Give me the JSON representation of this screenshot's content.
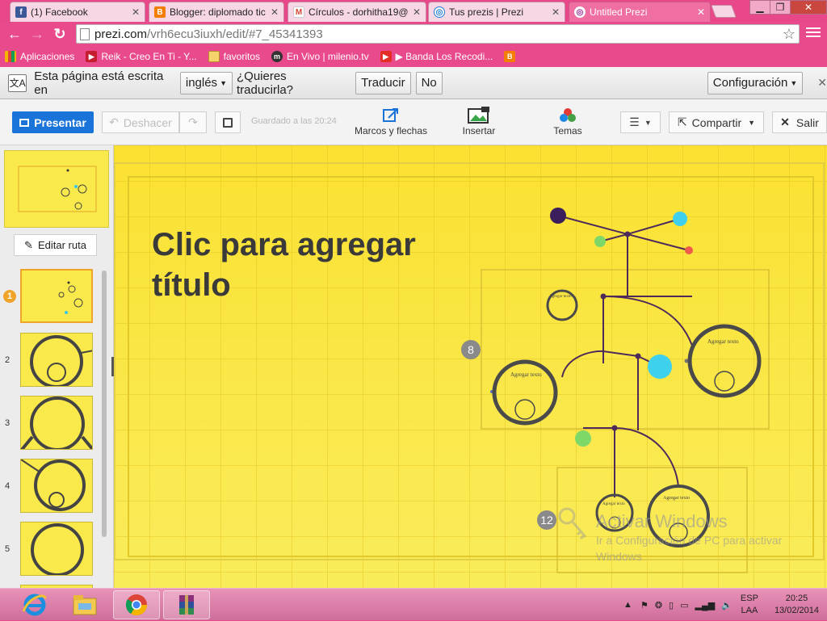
{
  "browser": {
    "tabs": [
      {
        "label": "(1) Facebook",
        "favicon": "facebook-icon",
        "color": "#3b5998",
        "glyph": "f"
      },
      {
        "label": "Blogger: diplomado tic",
        "favicon": "blogger-icon",
        "color": "#f57d00",
        "glyph": "B"
      },
      {
        "label": "Círculos - dorhitha19@",
        "favicon": "gmail-icon",
        "color": "#d14836",
        "glyph": "M"
      },
      {
        "label": "Tus prezis | Prezi",
        "favicon": "prezi-icon",
        "color": "#1f7ad3",
        "glyph": "◎"
      },
      {
        "label": "Untitled Prezi",
        "favicon": "prezi-icon",
        "color": "#9a2b9a",
        "glyph": "◎"
      }
    ],
    "url_host": "prezi.com",
    "url_path": "/vrh6ecu3iuxh/edit/#7_45341393",
    "bookmarks": [
      {
        "label": "Aplicaciones",
        "icon": "apps-grid-icon"
      },
      {
        "label": "Reik - Creo En Ti - Y...",
        "icon": "bookmark-icon"
      },
      {
        "label": "favoritos",
        "icon": "folder-icon"
      },
      {
        "label": "En Vivo | milenio.tv",
        "icon": "milenio-icon"
      },
      {
        "label": "▶ Banda Los Recodi...",
        "icon": "youtube-icon"
      },
      {
        "label": "",
        "icon": "blogger-icon"
      }
    ]
  },
  "translate": {
    "prefix": "Esta página está escrita en",
    "language": "inglés",
    "question": "¿Quieres traducirla?",
    "translate_btn": "Traducir",
    "no_btn": "No",
    "config_btn": "Configuración"
  },
  "prezi": {
    "present": "Presentar",
    "undo": "Deshacer",
    "saved": "Guardado a las 20:24",
    "frames": "Marcos y flechas",
    "insert": "Insertar",
    "themes": "Temas",
    "share": "Compartir",
    "exit": "Salir",
    "edit_path": "Editar ruta",
    "slides": [
      "1",
      "2",
      "3",
      "4",
      "5"
    ],
    "title": "Clic para agregar título",
    "badges": [
      "8",
      "12"
    ],
    "circle_text": "Agregar texto",
    "colors": {
      "background": "#fae94a",
      "accent": "#1a73d8",
      "circle": "#4a4a4a",
      "line": "#4d2a5a"
    }
  },
  "watermark": {
    "line1": "Activar Windows",
    "line2": "Ir a Configuración de PC para activar",
    "line3": "Windows"
  },
  "taskbar": {
    "lang1": "ESP",
    "lang2": "LAA",
    "time": "20:25",
    "date": "13/02/2014"
  }
}
